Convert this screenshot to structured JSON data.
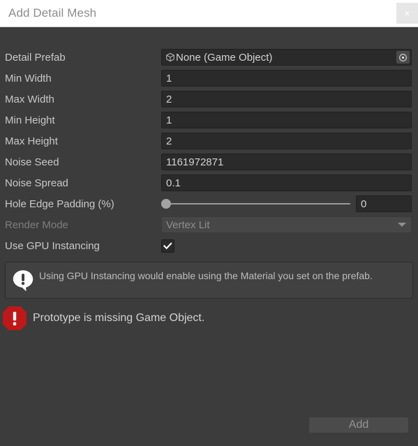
{
  "window": {
    "title": "Add Detail Mesh",
    "close_icon": "close-x-icon",
    "close_label": "×"
  },
  "fields": {
    "detail_prefab": {
      "label": "Detail Prefab",
      "value": "None (Game Object)",
      "type_icon": "game-object-cube-icon",
      "picker_icon": "object-picker-circle-icon"
    },
    "min_width": {
      "label": "Min Width",
      "value": "1"
    },
    "max_width": {
      "label": "Max Width",
      "value": "2"
    },
    "min_height": {
      "label": "Min Height",
      "value": "1"
    },
    "max_height": {
      "label": "Max Height",
      "value": "2"
    },
    "noise_seed": {
      "label": "Noise Seed",
      "value": "1161972871"
    },
    "noise_spread": {
      "label": "Noise Spread",
      "value": "0.1"
    },
    "hole_edge_padding": {
      "label": "Hole Edge Padding (%)",
      "value": "0",
      "slider_percent": 0
    },
    "render_mode": {
      "label": "Render Mode",
      "value": "Vertex Lit",
      "disabled": true,
      "caret_icon": "chevron-down-icon"
    },
    "use_gpu_instancing": {
      "label": "Use GPU Instancing",
      "checked": true,
      "check_icon": "checkmark-icon"
    }
  },
  "help": {
    "icon": "info-speech-bubble-icon",
    "text": "Using GPU Instancing would enable using the Material you set on the prefab."
  },
  "error": {
    "icon": "error-octagon-icon",
    "text": "Prototype is missing Game Object."
  },
  "footer": {
    "add_label": "Add",
    "add_disabled": true
  },
  "colors": {
    "window_background": "#3c3c3c",
    "titlebar_background": "#ffffff",
    "field_background": "#2a2a2a",
    "label_text": "#c8c8c8",
    "disabled_text": "#7e7e7e",
    "error_red": "#c01818",
    "helpbox_background": "#414141"
  }
}
